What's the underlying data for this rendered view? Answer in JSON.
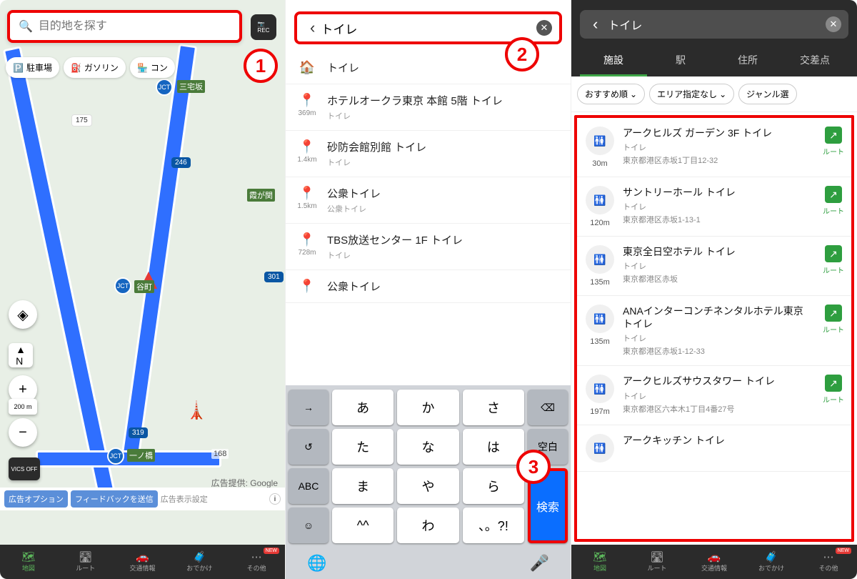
{
  "panel1": {
    "search_placeholder": "目的地を探す",
    "chips": [
      {
        "icon": "🅿️",
        "label": "駐車場"
      },
      {
        "icon": "⛽",
        "label": "ガソリン"
      },
      {
        "icon": "🏪",
        "label": "コン"
      }
    ],
    "badge": "1",
    "map_labels": {
      "miyakezaka": "三宅坂",
      "kasumi": "霞が関",
      "tanimachi": "谷町",
      "ichinohashi": "一ノ橋"
    },
    "shields": {
      "r175": "175",
      "r246": "246",
      "r301": "301",
      "r319": "319",
      "r168": "168"
    },
    "google_ad": "広告提供: Google",
    "ad_option": "広告オプション",
    "ad_feedback": "フィードバックを送信",
    "ad_settings": "広告表示設定",
    "scale": "200 m",
    "vics": "VICS OFF"
  },
  "panel2": {
    "search_value": "トイレ",
    "badge": "2",
    "suggestions": [
      {
        "icon": "home",
        "dist": "",
        "title": "トイレ",
        "sub": ""
      },
      {
        "icon": "pin",
        "dist": "369m",
        "title": "ホテルオークラ東京 本館 5階 トイレ",
        "sub": "トイレ"
      },
      {
        "icon": "pin",
        "dist": "1.4km",
        "title": "砂防会館別館 トイレ",
        "sub": "トイレ"
      },
      {
        "icon": "pin",
        "dist": "1.5km",
        "title": "公衆トイレ",
        "sub": "公衆トイレ"
      },
      {
        "icon": "pin",
        "dist": "728m",
        "title": "TBS放送センター 1F トイレ",
        "sub": "トイレ"
      },
      {
        "icon": "pin",
        "dist": "",
        "title": "公衆トイレ",
        "sub": ""
      }
    ],
    "keyboard_rows": [
      [
        "→",
        "あ",
        "か",
        "さ",
        "⌫"
      ],
      [
        "↺",
        "た",
        "な",
        "は",
        "空白"
      ],
      [
        "ABC",
        "ま",
        "や",
        "ら",
        "検索"
      ],
      [
        "☺",
        "^^",
        "わ",
        "、。?!",
        ""
      ]
    ],
    "badge3": "3"
  },
  "panel3": {
    "search_value": "トイレ",
    "tabs": [
      "施設",
      "駅",
      "住所",
      "交差点"
    ],
    "active_tab": 0,
    "filters": [
      {
        "label": "おすすめ順",
        "chev": true
      },
      {
        "label": "エリア指定なし",
        "chev": true
      },
      {
        "label": "ジャンル選",
        "chev": false
      }
    ],
    "results": [
      {
        "dist": "30m",
        "title": "アークヒルズ ガーデン 3F トイレ",
        "cat": "トイレ",
        "addr": "東京都港区赤坂1丁目12-32",
        "route": "ルート"
      },
      {
        "dist": "120m",
        "title": "サントリーホール トイレ",
        "cat": "トイレ",
        "addr": "東京都港区赤坂1-13-1",
        "route": "ルート"
      },
      {
        "dist": "135m",
        "title": "東京全日空ホテル トイレ",
        "cat": "トイレ",
        "addr": "東京都港区赤坂",
        "route": "ルート"
      },
      {
        "dist": "135m",
        "title": "ANAインターコンチネンタルホテル東京 トイレ",
        "cat": "トイレ",
        "addr": "東京都港区赤坂1-12-33",
        "route": "ルート"
      },
      {
        "dist": "197m",
        "title": "アークヒルズサウスタワー トイレ",
        "cat": "トイレ",
        "addr": "東京都港区六本木1丁目4番27号",
        "route": "ルート"
      },
      {
        "dist": "",
        "title": "アークキッチン トイレ",
        "cat": "",
        "addr": "",
        "route": ""
      }
    ]
  },
  "bottom_nav": [
    {
      "icon": "🗺",
      "label": "地図",
      "active": true,
      "new": false
    },
    {
      "icon": "🛣",
      "label": "ルート",
      "active": false,
      "new": false
    },
    {
      "icon": "🚗",
      "label": "交通情報",
      "active": false,
      "new": false
    },
    {
      "icon": "🧳",
      "label": "おでかけ",
      "active": false,
      "new": false
    },
    {
      "icon": "⋯",
      "label": "その他",
      "active": false,
      "new": true
    }
  ],
  "nav_new_label": "NEW"
}
